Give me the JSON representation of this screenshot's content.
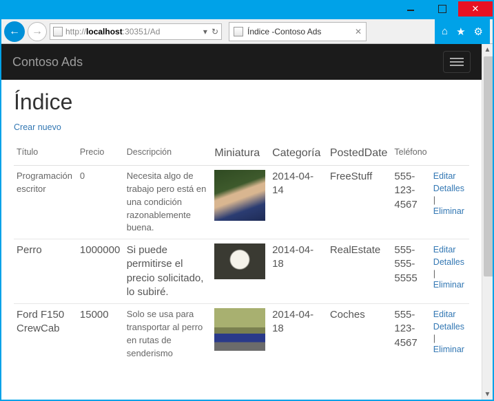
{
  "window": {
    "url_prefix": "http://",
    "url_host": "localhost",
    "url_suffix": ":30351/Ad",
    "tab_title": "Índice -Contoso Ads"
  },
  "nav": {
    "brand": "Contoso Ads"
  },
  "page": {
    "title": "Índice",
    "create_label": "Crear nuevo"
  },
  "headers": {
    "title": "Título",
    "price": "Precio",
    "desc": "Descripción",
    "thumb": "Miniatura",
    "category": "Categoría",
    "posted": "PostedDate",
    "phone": "Teléfono"
  },
  "actions": {
    "edit": "Editar",
    "details": "Detalles",
    "delete": "Eliminar",
    "sep": "|"
  },
  "rows": [
    {
      "title": "Programación escritor",
      "price": "0",
      "desc": "Necesita algo de trabajo pero está en una condición razonablemente buena.",
      "thumb_class": "person",
      "date": "2014-04-14",
      "category": "FreeStuff",
      "phone": "555-123-4567"
    },
    {
      "title": "Perro",
      "price": "1000000",
      "desc": "Si puede permitirse el precio solicitado, lo subiré.",
      "thumb_class": "cat",
      "date": "2014-04-18",
      "category": "RealEstate",
      "phone": "555-555-5555"
    },
    {
      "title": "Ford F150 CrewCab",
      "price": "15000",
      "desc": "Solo se usa para transportar al perro en rutas de senderismo",
      "thumb_class": "truck",
      "date": "2014-04-18",
      "category": "Coches",
      "phone": "555-123-4567"
    }
  ]
}
